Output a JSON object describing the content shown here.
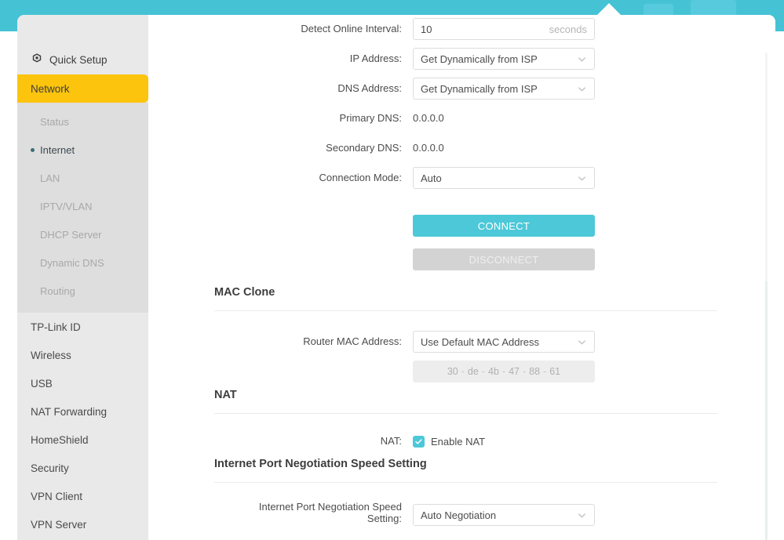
{
  "header": {
    "ghost_buttons": [
      "",
      ""
    ]
  },
  "sidebar": {
    "quick_setup": {
      "label": "Quick Setup",
      "icon": "gear-icon"
    },
    "active_section": {
      "label": "Network"
    },
    "submenu": [
      {
        "label": "Status",
        "selected": false
      },
      {
        "label": "Internet",
        "selected": true
      },
      {
        "label": "LAN",
        "selected": false
      },
      {
        "label": "IPTV/VLAN",
        "selected": false
      },
      {
        "label": "DHCP Server",
        "selected": false
      },
      {
        "label": "Dynamic DNS",
        "selected": false
      },
      {
        "label": "Routing",
        "selected": false
      }
    ],
    "items": [
      {
        "label": "TP-Link ID"
      },
      {
        "label": "Wireless"
      },
      {
        "label": "USB"
      },
      {
        "label": "NAT Forwarding"
      },
      {
        "label": "HomeShield"
      },
      {
        "label": "Security"
      },
      {
        "label": "VPN Client"
      },
      {
        "label": "VPN Server"
      }
    ]
  },
  "main": {
    "detect_online_interval": {
      "label": "Detect Online Interval:",
      "value": "10",
      "unit": "seconds"
    },
    "ip_address": {
      "label": "IP Address:",
      "value": "Get Dynamically from ISP"
    },
    "dns_address": {
      "label": "DNS Address:",
      "value": "Get Dynamically from ISP"
    },
    "primary_dns": {
      "label": "Primary DNS:",
      "value": "0.0.0.0"
    },
    "secondary_dns": {
      "label": "Secondary DNS:",
      "value": "0.0.0.0"
    },
    "connection_mode": {
      "label": "Connection Mode:",
      "value": "Auto"
    },
    "connect_button": {
      "label": "CONNECT"
    },
    "disconnect_button": {
      "label": "DISCONNECT"
    },
    "mac_clone": {
      "title": "MAC Clone",
      "router_mac_address": {
        "label": "Router MAC Address:",
        "value": "Use Default MAC Address"
      },
      "mac_octets": [
        "30",
        "de",
        "4b",
        "47",
        "88",
        "61"
      ],
      "mac_separator": "-"
    },
    "nat": {
      "title": "NAT",
      "label": "NAT:",
      "checkbox_label": "Enable NAT",
      "checked": true
    },
    "port_negotiation": {
      "title": "Internet Port Negotiation Speed Setting",
      "label_line1": "Internet Port Negotiation Speed",
      "label_line2": "Setting:",
      "value": "Auto Negotiation"
    }
  },
  "colors": {
    "header_teal": "#45c3d5",
    "accent_yellow": "#fcc40d",
    "primary_button": "#4dc8d8",
    "sidebar_bg": "#e9e9e9",
    "submenu_bg": "#dedede"
  }
}
